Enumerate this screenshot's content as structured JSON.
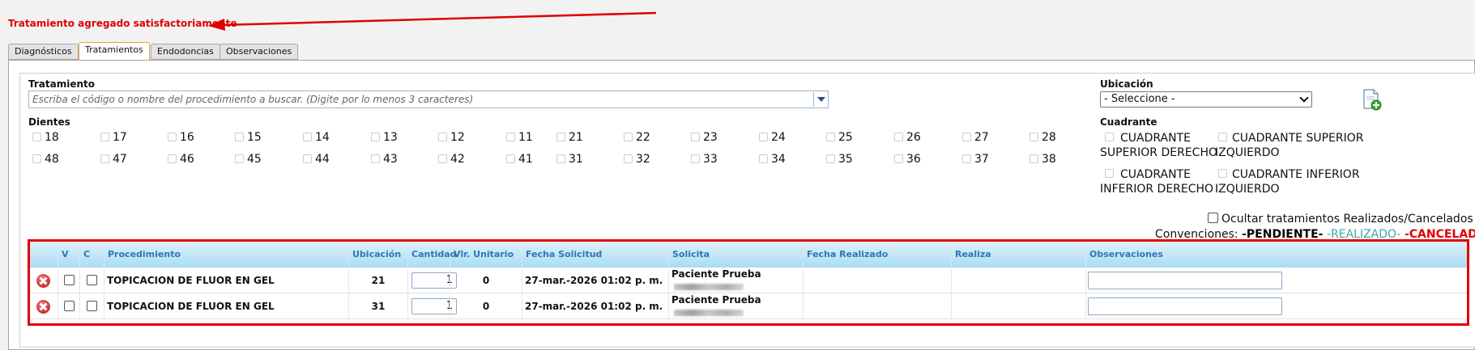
{
  "message": "Tratamiento agregado satisfactoriamente",
  "tabs": [
    "Diagnósticos",
    "Tratamientos",
    "Endodoncias",
    "Observaciones"
  ],
  "tratamiento": {
    "label": "Tratamiento",
    "placeholder": "Escriba el código o nombre del procedimiento a buscar. (Digite por lo menos 3 caracteres)"
  },
  "dientes": {
    "label": "Dientes",
    "row1": [
      "18",
      "17",
      "16",
      "15",
      "14",
      "13",
      "12",
      "11",
      "21",
      "22",
      "23",
      "24",
      "25",
      "26",
      "27",
      "28"
    ],
    "row2": [
      "48",
      "47",
      "46",
      "45",
      "44",
      "43",
      "42",
      "41",
      "31",
      "32",
      "33",
      "34",
      "35",
      "36",
      "37",
      "38"
    ]
  },
  "ubicacion": {
    "label": "Ubicación",
    "selected": "- Seleccione -"
  },
  "add_icon": "add-document-icon",
  "cuadrante": {
    "label": "Cuadrante",
    "options": [
      [
        "CUADRANTE",
        "SUPERIOR DERECHO"
      ],
      [
        "CUADRANTE SUPERIOR",
        "IZQUIERDO"
      ],
      [
        "CUADRANTE",
        "INFERIOR DERECHO"
      ],
      [
        "CUADRANTE INFERIOR",
        "IZQUIERDO"
      ]
    ]
  },
  "ocultar_label": "Ocultar tratamientos Realizados/Cancelados",
  "convenciones": {
    "label": "Convenciones:",
    "pendiente": "-PENDIENTE-",
    "realizado": "-REALIZADO-",
    "cancelado": "-CANCELADO-",
    "colors": {
      "pendiente": "#000000",
      "realizado": "#3aa6a6",
      "cancelado": "#e00000"
    }
  },
  "grid": {
    "headers": [
      "V",
      "C",
      "Procedimiento",
      "Ubicación",
      "Cantidad",
      "Vlr. Unitario",
      "Fecha Solicitud",
      "Solicita",
      "Fecha Realizado",
      "Realiza",
      "Observaciones"
    ],
    "rows": [
      {
        "procedimiento": "TOPICACION DE FLUOR EN GEL",
        "ubicacion": "21",
        "cantidad": "1",
        "vlr": "0",
        "fecha": "27-mar.-2026 01:02 p. m.",
        "solicita": "Paciente Prueba"
      },
      {
        "procedimiento": "TOPICACION DE FLUOR EN GEL",
        "ubicacion": "31",
        "cantidad": "1",
        "vlr": "0",
        "fecha": "27-mar.-2026 01:02 p. m.",
        "solicita": "Paciente Prueba"
      }
    ]
  },
  "colors": {
    "accent_red": "#e00000",
    "header_text": "#2f76b6",
    "active_tab_border": "#e8a23a"
  }
}
